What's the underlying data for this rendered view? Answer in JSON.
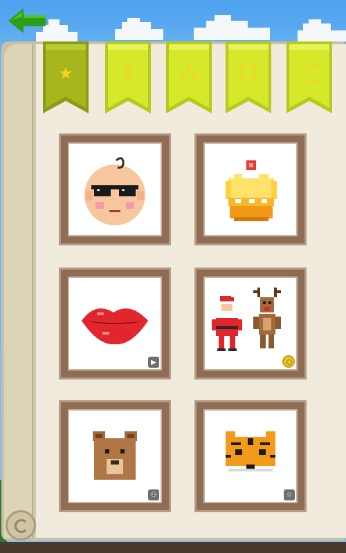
{
  "nav": {
    "back_icon": "left-arrow-icon"
  },
  "tabs": [
    {
      "id": "level-1",
      "stars": 1,
      "selected": true,
      "star_glyph": "★"
    },
    {
      "id": "level-2",
      "stars": 2,
      "selected": false,
      "star_glyph": "★"
    },
    {
      "id": "level-3",
      "stars": 3,
      "selected": false,
      "star_glyph": "★"
    },
    {
      "id": "level-4",
      "stars": 4,
      "selected": false,
      "star_glyph": "★"
    },
    {
      "id": "level-5",
      "stars": 5,
      "selected": false,
      "star_glyph": "★"
    }
  ],
  "pictures": [
    {
      "id": "baby-with-sunglasses",
      "badge": "none"
    },
    {
      "id": "cake",
      "badge": "none"
    },
    {
      "id": "lips",
      "badge": "play-icon"
    },
    {
      "id": "santa-and-reindeer",
      "badge": "coin-icon"
    },
    {
      "id": "bear",
      "badge": "share-icon"
    },
    {
      "id": "tiger",
      "badge": "star-icon"
    }
  ],
  "colors": {
    "ribbon_selected": "#8a9b14",
    "ribbon_normal": "#d5e82a",
    "star": "#f7d21c",
    "frame": "#8f6d55",
    "page": "#f0ebdc"
  }
}
